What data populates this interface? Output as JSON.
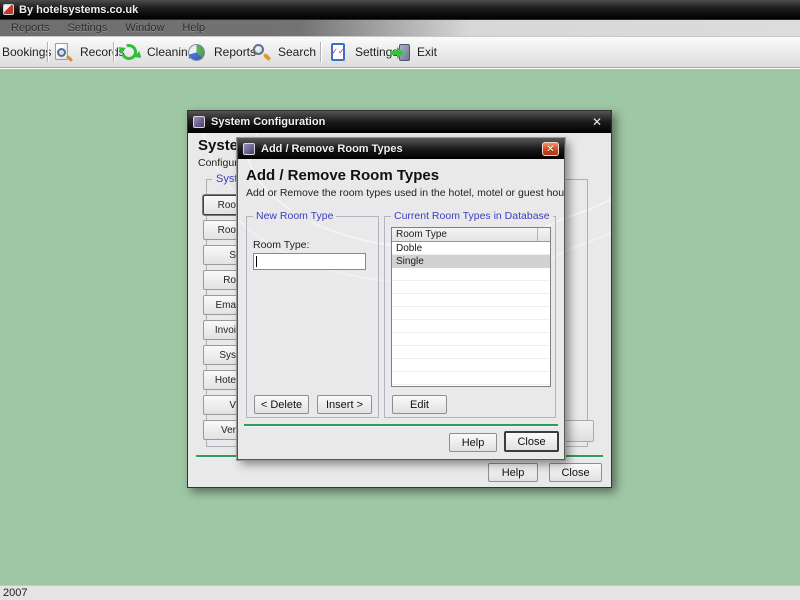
{
  "window": {
    "title": "By hotelsystems.co.uk",
    "status": "2007"
  },
  "menu_bar": {
    "items": [
      "Reports",
      "Settings",
      "Window",
      "Help"
    ]
  },
  "toolbar": {
    "bookings": {
      "label": "Bookings"
    },
    "items": [
      {
        "label": "Records",
        "icon": "records-icon"
      },
      {
        "label": "Cleaning",
        "icon": "cleaning-icon"
      },
      {
        "label": "Reports",
        "icon": "reports-icon"
      },
      {
        "label": "Search",
        "icon": "search-icon"
      },
      {
        "label": "Settings",
        "icon": "settings-icon"
      },
      {
        "label": "Exit",
        "icon": "exit-icon"
      }
    ]
  },
  "config_dialog": {
    "title": "System Configuration",
    "heading": "System",
    "subheading": "Configure",
    "tab_label": "System",
    "nav_buttons": [
      {
        "label": "Roo"
      },
      {
        "label": "Roo"
      },
      {
        "label": "S"
      },
      {
        "label": "Ro"
      },
      {
        "label": "Ema"
      },
      {
        "label": "Invoi"
      },
      {
        "label": "Sys"
      },
      {
        "label": "Hote"
      },
      {
        "label": "V"
      },
      {
        "label": "Ver"
      }
    ],
    "help_label": "Help",
    "close_label": "Close"
  },
  "room_dialog": {
    "title": "Add / Remove Room Types",
    "heading": "Add / Remove Room Types",
    "description": "Add or Remove the room types used in the hotel, motel or guest house.",
    "new_group": {
      "label": "New Room Type",
      "field_label": "Room Type:",
      "field_value": ""
    },
    "current_group": {
      "label": "Current Room Types in Database",
      "column_header": "Room Type",
      "rows": [
        {
          "label": "Doble",
          "selected": false
        },
        {
          "label": "Single",
          "selected": true
        }
      ]
    },
    "delete_label": "< Delete",
    "insert_label": "Insert >",
    "edit_label": "Edit",
    "help_label": "Help",
    "close_label": "Close"
  },
  "icons": {
    "close_glyph": "✕",
    "settings_checks": "✓✓"
  },
  "colors": {
    "desktop_green": "#9ec7a4",
    "separator_green": "#2f9e57",
    "group_label_blue": "#3d3dc0",
    "titlebar_dark": "#1a1a1a",
    "close_button_red": "#d24a1e",
    "selection_gray": "#d2d2d2"
  }
}
